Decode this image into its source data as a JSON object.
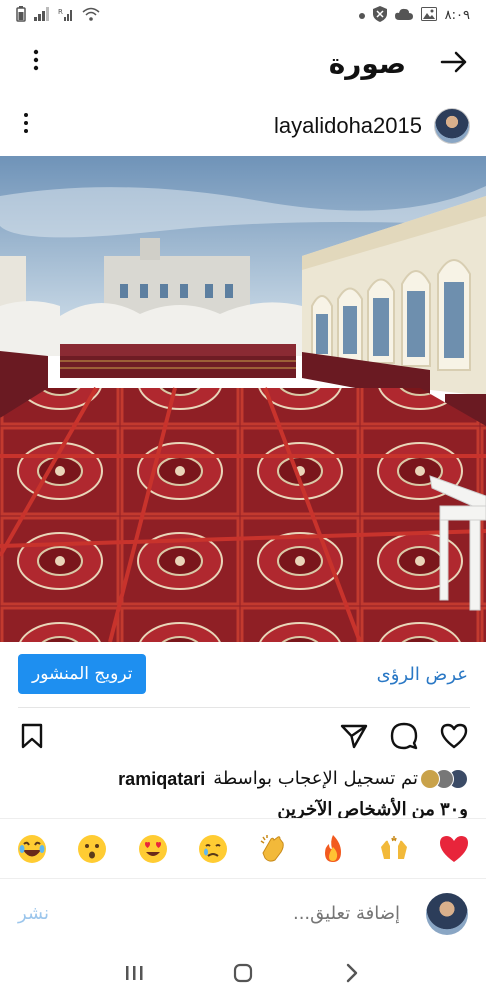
{
  "status_bar": {
    "time": "٨:٠٩",
    "icons_right": [
      "dot-icon",
      "shield-icon",
      "cloud-icon",
      "image-icon"
    ],
    "icons_left": [
      "battery-icon",
      "signal-icon",
      "signal-r-icon",
      "wifi-icon"
    ]
  },
  "header": {
    "title": "صورة",
    "back_icon": "arrow-right-icon",
    "menu_icon": "kebab-icon"
  },
  "post": {
    "username": "layalidoha2015",
    "menu_icon": "kebab-icon"
  },
  "actions": {
    "view_insights": "عرض الرؤى",
    "promote": "ترويج المنشور"
  },
  "icons": {
    "like": "heart-icon",
    "comment": "comment-icon",
    "share": "send-icon",
    "save": "bookmark-icon"
  },
  "likes": {
    "prefix": "تم تسجيل الإعجاب بواسطة",
    "user": "ramiqatari",
    "suffix": "و٣٠ من الأشخاص الآخرين"
  },
  "emojis": [
    "red-heart",
    "raising-hands",
    "fire",
    "clapping-hands",
    "crying-face",
    "heart-eyes",
    "surprised-face",
    "laughing-face"
  ],
  "comment": {
    "placeholder": "إضافة تعليق...",
    "post_label": "نشر"
  },
  "nav": [
    "recents-icon",
    "home-icon",
    "back-icon"
  ]
}
